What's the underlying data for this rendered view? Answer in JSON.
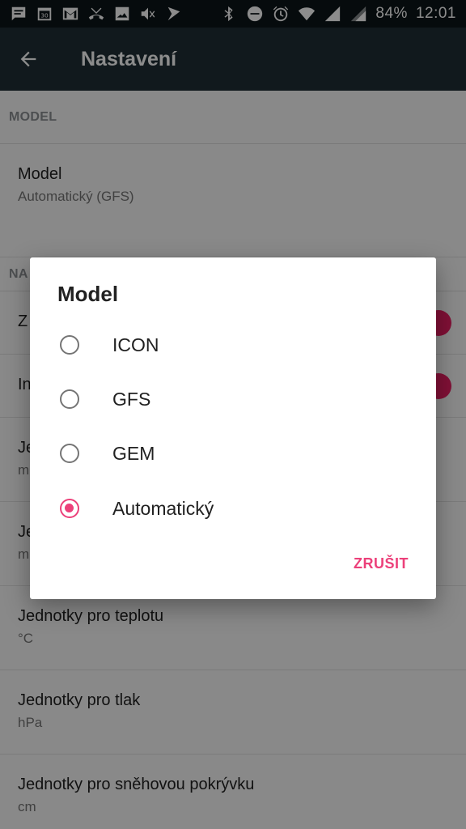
{
  "status_bar": {
    "battery": "84%",
    "time": "12:01",
    "left_icons": [
      "message-icon",
      "calendar-icon",
      "gmail-icon",
      "missed-call-icon",
      "image-icon",
      "mute-icon",
      "check-icon"
    ],
    "right_icons": [
      "bluetooth-icon",
      "dnd-icon",
      "alarm-icon",
      "wifi-icon",
      "signal-icon",
      "signal2-icon"
    ]
  },
  "toolbar": {
    "title": "Nastavení",
    "back_icon": "arrow-back-icon"
  },
  "settings": {
    "section_model": "MODEL",
    "model_item": {
      "title": "Model",
      "summary": "Automatický (GFS)"
    },
    "section_partial": "NA",
    "item_partial_1": "Z",
    "item_partial_2": "In",
    "item_partial_3_title": "Je",
    "item_partial_3_summary": "m",
    "item_partial_4_title": "Je",
    "item_partial_4_summary": "m",
    "temperature": {
      "title": "Jednotky pro teplotu",
      "summary": "°C"
    },
    "pressure": {
      "title": "Jednotky pro tlak",
      "summary": "hPa"
    },
    "snow": {
      "title": "Jednotky pro sněhovou pokrývku",
      "summary": "cm"
    }
  },
  "dialog": {
    "title": "Model",
    "options": [
      {
        "label": "ICON",
        "checked": false
      },
      {
        "label": "GFS",
        "checked": false
      },
      {
        "label": "GEM",
        "checked": false
      },
      {
        "label": "Automatický",
        "checked": true
      }
    ],
    "cancel_label": "ZRUŠIT"
  },
  "colors": {
    "accent": "#ec407a",
    "toolbar": "#1f2f35",
    "status_bar": "#0c1518"
  }
}
